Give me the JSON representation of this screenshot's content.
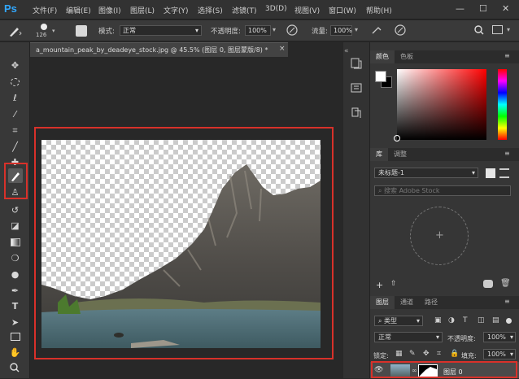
{
  "app": {
    "logo": "Ps"
  },
  "menu": [
    "文件(F)",
    "编辑(E)",
    "图像(I)",
    "图层(L)",
    "文字(Y)",
    "选择(S)",
    "滤镜(T)",
    "3D(D)",
    "视图(V)",
    "窗口(W)",
    "帮助(H)"
  ],
  "window_controls": {
    "minimize": "—",
    "maximize": "☐",
    "close": "✕"
  },
  "options": {
    "brush_size": "126",
    "mode_label": "模式:",
    "mode_value": "正常",
    "opacity_label": "不透明度:",
    "opacity_value": "100%",
    "flow_label": "流量:",
    "flow_value": "100%"
  },
  "document": {
    "tab_title": "a_mountain_peak_by_deadeye_stock.jpg @ 45.5% (图层 0, 图层蒙版/8) *",
    "close": "×"
  },
  "color_panel": {
    "tabs": [
      "颜色",
      "色板"
    ]
  },
  "library_panel": {
    "tabs": [
      "库",
      "调整"
    ],
    "library_name": "未标题-1",
    "search_placeholder": "搜索 Adobe Stock",
    "add_symbol": "+"
  },
  "layers_panel": {
    "tabs": [
      "图层",
      "通道",
      "路径"
    ],
    "filter_label": "类型",
    "blend_mode": "正常",
    "opacity_label": "不透明度:",
    "opacity_value": "100%",
    "lock_label": "锁定:",
    "fill_label": "填充:",
    "fill_value": "100%",
    "layer_name": "图层 0"
  },
  "colors": {
    "accent": "#31a8ff",
    "highlight_box": "#d8312a"
  }
}
